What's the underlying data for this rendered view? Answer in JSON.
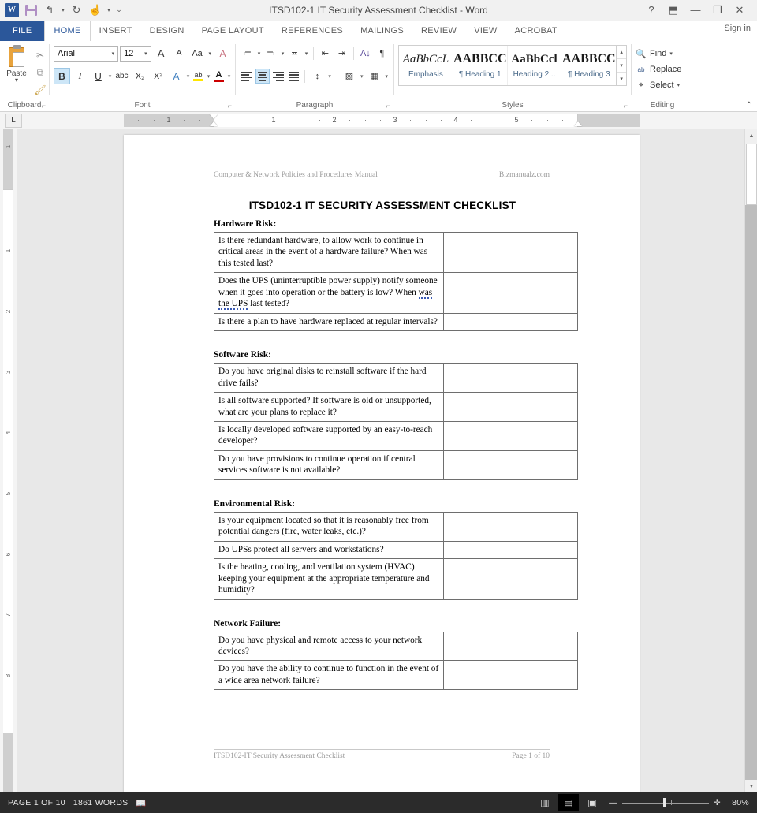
{
  "titlebar": {
    "document_title": "ITSD102-1 IT Security Assessment Checklist - Word",
    "quick_access": [
      {
        "name": "word-logo-icon",
        "glyph": "W"
      },
      {
        "name": "save-icon",
        "glyph": ""
      },
      {
        "name": "undo-icon",
        "glyph": "↰"
      },
      {
        "name": "undo-dropdown-icon",
        "glyph": "▾"
      },
      {
        "name": "redo-icon",
        "glyph": "↻"
      },
      {
        "name": "touch-mode-icon",
        "glyph": "☝"
      },
      {
        "name": "touch-dropdown-icon",
        "glyph": "▾"
      },
      {
        "name": "customize-qat-icon",
        "glyph": "⌄"
      }
    ],
    "window_controls": [
      {
        "name": "help-button",
        "glyph": "?"
      },
      {
        "name": "ribbon-display-options-button",
        "glyph": "⬒"
      },
      {
        "name": "minimize-button",
        "glyph": "—"
      },
      {
        "name": "restore-button",
        "glyph": "❐"
      },
      {
        "name": "close-button",
        "glyph": "✕"
      }
    ]
  },
  "tabs": {
    "file_label": "FILE",
    "items": [
      "HOME",
      "INSERT",
      "DESIGN",
      "PAGE LAYOUT",
      "REFERENCES",
      "MAILINGS",
      "REVIEW",
      "VIEW",
      "ACROBAT"
    ],
    "active": "HOME",
    "sign_in": "Sign in"
  },
  "ribbon": {
    "clipboard": {
      "label": "Clipboard",
      "paste_label": "Paste",
      "paste_arrow": "▾",
      "cut_icon": "✂",
      "copy_icon": "⧉",
      "format_painter_icon": "🖌",
      "launcher": "⌐"
    },
    "font": {
      "label": "Font",
      "font_name": "Arial",
      "font_size": "12",
      "grow_font": "A",
      "shrink_font": "A",
      "change_case": "Aa",
      "clear_formatting": "A",
      "bold": "B",
      "italic": "I",
      "underline": "U",
      "strikethrough": "abc",
      "subscript": "X₂",
      "superscript": "X²",
      "text_effects": "A",
      "highlight": "ab",
      "font_color": "A",
      "launcher": "⌐"
    },
    "paragraph": {
      "label": "Paragraph",
      "bullets": "≔",
      "numbering": "≕",
      "multilevel": "≖",
      "decrease_indent": "⇤",
      "increase_indent": "⇥",
      "sort": "A↓",
      "show_marks": "¶",
      "align_left": "align-left",
      "align_center": "align-center",
      "align_right": "align-right",
      "justify": "justify",
      "line_spacing": "↕",
      "shading": "▨",
      "borders": "▦",
      "launcher": "⌐"
    },
    "styles": {
      "label": "Styles",
      "launcher": "⌐",
      "gallery": [
        {
          "preview": "AaBbCcL",
          "name": "Emphasis",
          "bold": false,
          "italic": true
        },
        {
          "preview": "AABBCC",
          "name": "¶ Heading 1",
          "bold": true,
          "italic": false
        },
        {
          "preview": "AaBbCcl",
          "name": "Heading 2...",
          "bold": true,
          "italic": false
        },
        {
          "preview": "AABBCC",
          "name": "¶ Heading 3",
          "bold": true,
          "italic": false
        }
      ],
      "scroll_up": "▴",
      "scroll_down": "▾",
      "more": "▾"
    },
    "editing": {
      "label": "Editing",
      "find": "Find",
      "find_arrow": "▾",
      "replace": "Replace",
      "select": "Select",
      "select_arrow": "▾",
      "find_icon": "🔍",
      "replace_icon": "ab",
      "select_icon": "⌖"
    },
    "collapse_ribbon": "⌃"
  },
  "ruler": {
    "tab_selector": "L",
    "h_numbers": [
      "1",
      "1",
      "2",
      "3",
      "4",
      "5"
    ],
    "v_numbers": [
      "1",
      "1",
      "2",
      "3",
      "4",
      "5",
      "6",
      "7",
      "8"
    ]
  },
  "document": {
    "header_left": "Computer & Network Policies and Procedures Manual",
    "header_right": "Bizmanualz.com",
    "title": "ITSD102-1   IT SECURITY ASSESSMENT CHECKLIST",
    "sections": [
      {
        "heading": "Hardware Risk:",
        "rows": [
          {
            "question": "Is there redundant hardware, to allow work to continue in critical areas in the event of a hardware failure?  When was this tested last?",
            "answer": ""
          },
          {
            "question": "Does the UPS (uninterruptible power supply) notify someone when it goes into operation or the battery is low? When ",
            "grammar": "was the UPS",
            "question_tail": " last tested?",
            "answer": ""
          },
          {
            "question": "Is there a plan to have hardware replaced at regular intervals?",
            "answer": ""
          }
        ]
      },
      {
        "heading": "Software Risk:",
        "rows": [
          {
            "question": "Do you have original disks to reinstall software if the hard drive fails?",
            "answer": ""
          },
          {
            "question": "Is all software supported?  If software is old or unsupported, what are your plans to replace it?",
            "answer": ""
          },
          {
            "question": "Is locally developed software supported by an easy-to-reach developer?",
            "answer": ""
          },
          {
            "question": "Do you have provisions to continue operation if central services software is not available?",
            "answer": ""
          }
        ]
      },
      {
        "heading": "Environmental Risk:",
        "rows": [
          {
            "question": "Is your equipment located so that it is reasonably free from potential dangers (fire, water leaks, etc.)?",
            "answer": ""
          },
          {
            "question": "Do UPSs protect all servers and workstations?",
            "answer": ""
          },
          {
            "question": "Is the heating, cooling, and ventilation system (HVAC) keeping your equipment at the appropriate temperature and humidity?",
            "answer": ""
          }
        ]
      },
      {
        "heading": "Network Failure:",
        "rows": [
          {
            "question": "Do you have physical and remote access to your network devices?",
            "answer": ""
          },
          {
            "question": "Do you have the ability to continue to function in the event of a wide area network failure?",
            "answer": ""
          }
        ]
      }
    ],
    "footer_left": "ITSD102-IT Security Assessment Checklist",
    "footer_right": "Page 1 of 10"
  },
  "statusbar": {
    "page_count": "PAGE 1 OF 10",
    "word_count": "1861 WORDS",
    "proofing_icon": "proofing-errors-icon",
    "views": [
      {
        "name": "read-mode-view-button",
        "glyph": "▥",
        "active": false
      },
      {
        "name": "print-layout-view-button",
        "glyph": "▤",
        "active": true
      },
      {
        "name": "web-layout-view-button",
        "glyph": "▣",
        "active": false
      }
    ],
    "zoom_out": "—",
    "zoom_in": "✛",
    "zoom_level": "80%"
  }
}
